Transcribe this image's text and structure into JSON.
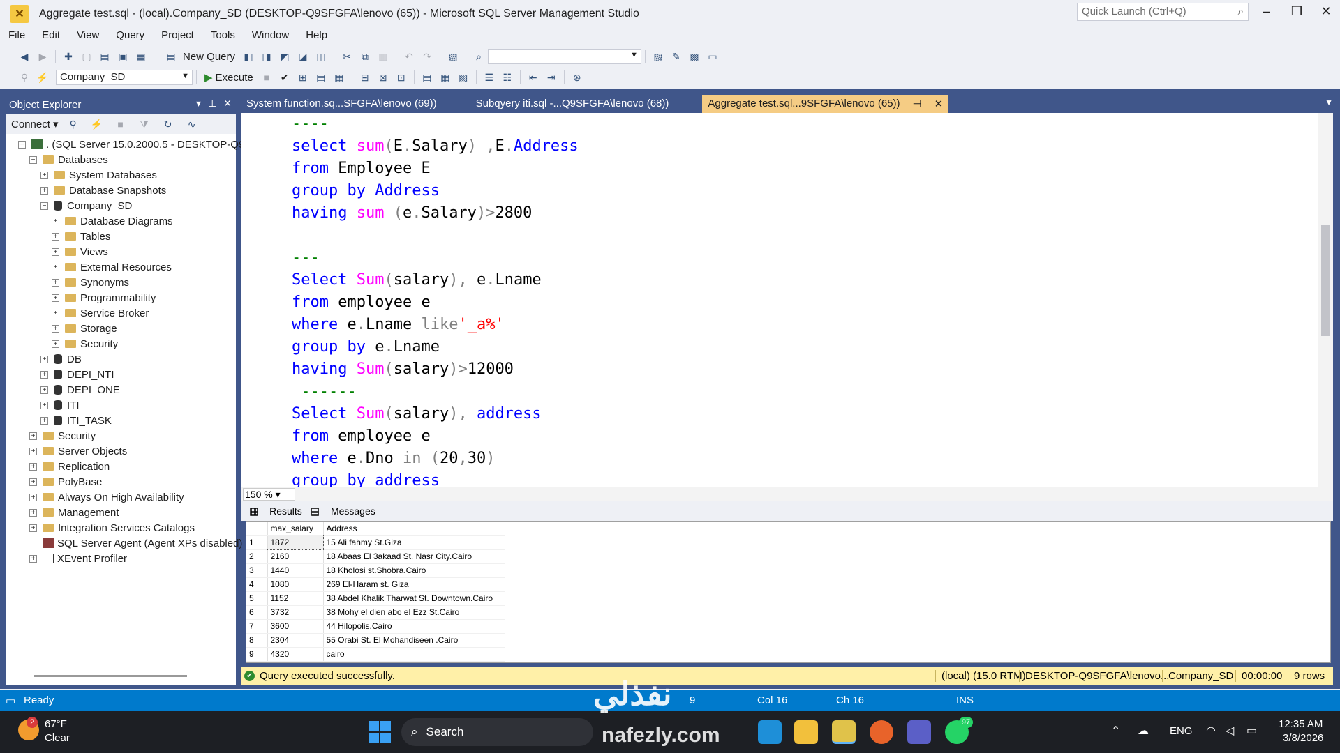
{
  "window": {
    "title": "Aggregate test.sql - (local).Company_SD (DESKTOP-Q9SFGFA\\lenovo (65)) - Microsoft SQL Server Management Studio",
    "quick_launch_placeholder": "Quick Launch (Ctrl+Q)"
  },
  "menu": [
    "File",
    "Edit",
    "View",
    "Query",
    "Project",
    "Tools",
    "Window",
    "Help"
  ],
  "toolbar": {
    "new_query": "New Query",
    "database": "Company_SD",
    "execute": "Execute"
  },
  "object_explorer": {
    "title": "Object Explorer",
    "connect": "Connect",
    "nodes": [
      {
        "label": ". (SQL Server 15.0.2000.5 - DESKTOP-Q9SFG",
        "expand": "−",
        "icon": "server"
      },
      {
        "label": "Databases",
        "expand": "−",
        "icon": "folder"
      },
      {
        "label": "System Databases",
        "expand": "+",
        "icon": "folder"
      },
      {
        "label": "Database Snapshots",
        "expand": "+",
        "icon": "folder"
      },
      {
        "label": "Company_SD",
        "expand": "−",
        "icon": "db"
      },
      {
        "label": "Database Diagrams",
        "expand": "+",
        "icon": "folder"
      },
      {
        "label": "Tables",
        "expand": "+",
        "icon": "folder"
      },
      {
        "label": "Views",
        "expand": "+",
        "icon": "folder"
      },
      {
        "label": "External Resources",
        "expand": "+",
        "icon": "folder"
      },
      {
        "label": "Synonyms",
        "expand": "+",
        "icon": "folder"
      },
      {
        "label": "Programmability",
        "expand": "+",
        "icon": "folder"
      },
      {
        "label": "Service Broker",
        "expand": "+",
        "icon": "folder"
      },
      {
        "label": "Storage",
        "expand": "+",
        "icon": "folder"
      },
      {
        "label": "Security",
        "expand": "+",
        "icon": "folder"
      },
      {
        "label": "DB",
        "expand": "+",
        "icon": "db"
      },
      {
        "label": "DEPI_NTI",
        "expand": "+",
        "icon": "db"
      },
      {
        "label": "DEPI_ONE",
        "expand": "+",
        "icon": "db"
      },
      {
        "label": "ITI",
        "expand": "+",
        "icon": "db"
      },
      {
        "label": "ITI_TASK",
        "expand": "+",
        "icon": "db"
      },
      {
        "label": "Security",
        "expand": "+",
        "icon": "folder"
      },
      {
        "label": "Server Objects",
        "expand": "+",
        "icon": "folder"
      },
      {
        "label": "Replication",
        "expand": "+",
        "icon": "folder"
      },
      {
        "label": "PolyBase",
        "expand": "+",
        "icon": "folder"
      },
      {
        "label": "Always On High Availability",
        "expand": "+",
        "icon": "folder"
      },
      {
        "label": "Management",
        "expand": "+",
        "icon": "folder"
      },
      {
        "label": "Integration Services Catalogs",
        "expand": "+",
        "icon": "folder"
      },
      {
        "label": "SQL Server Agent (Agent XPs disabled)",
        "expand": "",
        "icon": "agent"
      },
      {
        "label": "XEvent Profiler",
        "expand": "+",
        "icon": "profiler"
      }
    ]
  },
  "tabs": [
    "System function.sq...SFGFA\\lenovo (69))",
    "Subqyery iti.sql -...Q9SFGFA\\lenovo (68))",
    "Aggregate test.sql...9SFGFA\\lenovo (65))"
  ],
  "editor": {
    "zoom": "150 %",
    "lines": [
      [
        [
          "cm",
          "----"
        ]
      ],
      [
        [
          "kw",
          "select "
        ],
        [
          "fn",
          "sum"
        ],
        [
          "gr",
          "("
        ],
        [
          "pl",
          "E"
        ],
        [
          "gr",
          "."
        ],
        [
          "pl",
          "Salary"
        ],
        [
          "gr",
          ") ,"
        ],
        [
          "pl",
          "E"
        ],
        [
          "gr",
          "."
        ],
        [
          "kw",
          "Address"
        ]
      ],
      [
        [
          "kw",
          "from "
        ],
        [
          "pl",
          "Employee E"
        ]
      ],
      [
        [
          "kw",
          "group by "
        ],
        [
          "kw",
          "Address"
        ]
      ],
      [
        [
          "kw",
          "having "
        ],
        [
          "fn",
          "sum "
        ],
        [
          "gr",
          "("
        ],
        [
          "pl",
          "e"
        ],
        [
          "gr",
          "."
        ],
        [
          "pl",
          "Salary"
        ],
        [
          "gr",
          ")>"
        ],
        [
          "pl",
          "2800"
        ]
      ],
      [],
      [
        [
          "cm",
          "---"
        ]
      ],
      [
        [
          "kw",
          "Select "
        ],
        [
          "fn",
          "Sum"
        ],
        [
          "gr",
          "("
        ],
        [
          "pl",
          "salary"
        ],
        [
          "gr",
          "), "
        ],
        [
          "pl",
          "e"
        ],
        [
          "gr",
          "."
        ],
        [
          "pl",
          "Lname"
        ]
      ],
      [
        [
          "kw",
          "from "
        ],
        [
          "pl",
          "employee e"
        ]
      ],
      [
        [
          "kw",
          "where "
        ],
        [
          "pl",
          "e"
        ],
        [
          "gr",
          "."
        ],
        [
          "pl",
          "Lname "
        ],
        [
          "gr",
          "like"
        ],
        [
          "st",
          "'_a%'"
        ]
      ],
      [
        [
          "kw",
          "group by "
        ],
        [
          "pl",
          "e"
        ],
        [
          "gr",
          "."
        ],
        [
          "pl",
          "Lname"
        ]
      ],
      [
        [
          "kw",
          "having "
        ],
        [
          "fn",
          "Sum"
        ],
        [
          "gr",
          "("
        ],
        [
          "pl",
          "salary"
        ],
        [
          "gr",
          ")>"
        ],
        [
          "pl",
          "12000"
        ]
      ],
      [
        [
          "cm",
          " ------"
        ]
      ],
      [
        [
          "kw",
          "Select "
        ],
        [
          "fn",
          "Sum"
        ],
        [
          "gr",
          "("
        ],
        [
          "pl",
          "salary"
        ],
        [
          "gr",
          "), "
        ],
        [
          "kw",
          "address"
        ]
      ],
      [
        [
          "kw",
          "from "
        ],
        [
          "pl",
          "employee e"
        ]
      ],
      [
        [
          "kw",
          "where "
        ],
        [
          "pl",
          "e"
        ],
        [
          "gr",
          "."
        ],
        [
          "pl",
          "Dno "
        ],
        [
          "gr",
          "in ("
        ],
        [
          "pl",
          "20"
        ],
        [
          "gr",
          ","
        ],
        [
          "pl",
          "30"
        ],
        [
          "gr",
          ")"
        ]
      ],
      [
        [
          "kw",
          "group by "
        ],
        [
          "kw",
          "address"
        ]
      ]
    ]
  },
  "results": {
    "tab_results": "Results",
    "tab_messages": "Messages",
    "columns": [
      "max_salary",
      "Address"
    ],
    "rows": [
      [
        "1",
        "1872",
        "15 Ali fahmy St.Giza"
      ],
      [
        "2",
        "2160",
        "18 Abaas El 3akaad St. Nasr City.Cairo"
      ],
      [
        "3",
        "1440",
        "18 Kholosi st.Shobra.Cairo"
      ],
      [
        "4",
        "1080",
        "269 El-Haram st. Giza"
      ],
      [
        "5",
        "1152",
        "38 Abdel Khalik Tharwat St. Downtown.Cairo"
      ],
      [
        "6",
        "3732",
        "38 Mohy el dien abo el Ezz  St.Cairo"
      ],
      [
        "7",
        "3600",
        "44 Hilopolis.Cairo"
      ],
      [
        "8",
        "2304",
        "55 Orabi St. El Mohandiseen .Cairo"
      ],
      [
        "9",
        "4320",
        "cairo"
      ]
    ]
  },
  "query_status": {
    "message": "Query executed successfully.",
    "server": "(local) (15.0 RTM)",
    "user": "DESKTOP-Q9SFGFA\\lenovo...",
    "database": "Company_SD",
    "time": "00:00:00",
    "rows": "9 rows"
  },
  "status_bar": {
    "ready": "Ready",
    "ln": "9",
    "col": "Col 16",
    "ch": "Ch 16",
    "ins": "INS"
  },
  "taskbar": {
    "weather_temp": "67°F",
    "weather_desc": "Clear",
    "weather_badge": "2",
    "search": "Search",
    "lang": "ENG",
    "time": "12:35 AM",
    "date": "3/8/2026",
    "whatsapp_badge": "97"
  },
  "watermark": {
    "arabic": "نفذلي",
    "site": "nafezly.com"
  }
}
